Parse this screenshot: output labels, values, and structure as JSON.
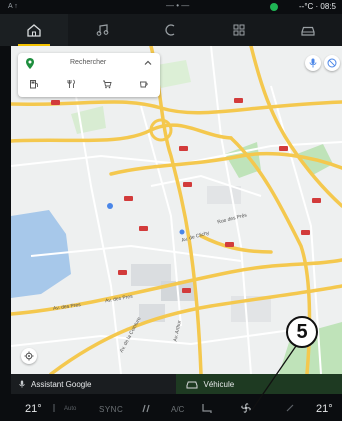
{
  "status_bar": {
    "left_text": "A ↑",
    "time": "08:5",
    "temperature": "--°C",
    "status_dot_color": "#1fb454"
  },
  "top_nav": {
    "tabs": [
      {
        "name": "home-icon",
        "active": true
      },
      {
        "name": "music-icon",
        "active": false
      },
      {
        "name": "phone-icon",
        "active": false
      },
      {
        "name": "apps-icon",
        "active": false
      },
      {
        "name": "car-icon",
        "active": false
      }
    ],
    "accent_color": "#f2c100"
  },
  "map": {
    "search": {
      "placeholder": "Rechercher",
      "categories": [
        "gas-station-icon",
        "restaurant-icon",
        "shopping-icon",
        "coffee-icon"
      ]
    },
    "road_labels": [
      "Av. de Clichy",
      "Av. des Pres",
      "Av. des Pres",
      "Av. de la Ceinture",
      "Av. Arthur",
      "Rue des Prés"
    ]
  },
  "callout": {
    "number": "5"
  },
  "widgets": {
    "assistant": "Assistant Google",
    "vehicle": "Véhicule"
  },
  "climate": {
    "temp_left": "21°",
    "temp_right": "21°",
    "sync": "SYNC",
    "ac": "A/C",
    "auto": "Auto"
  }
}
